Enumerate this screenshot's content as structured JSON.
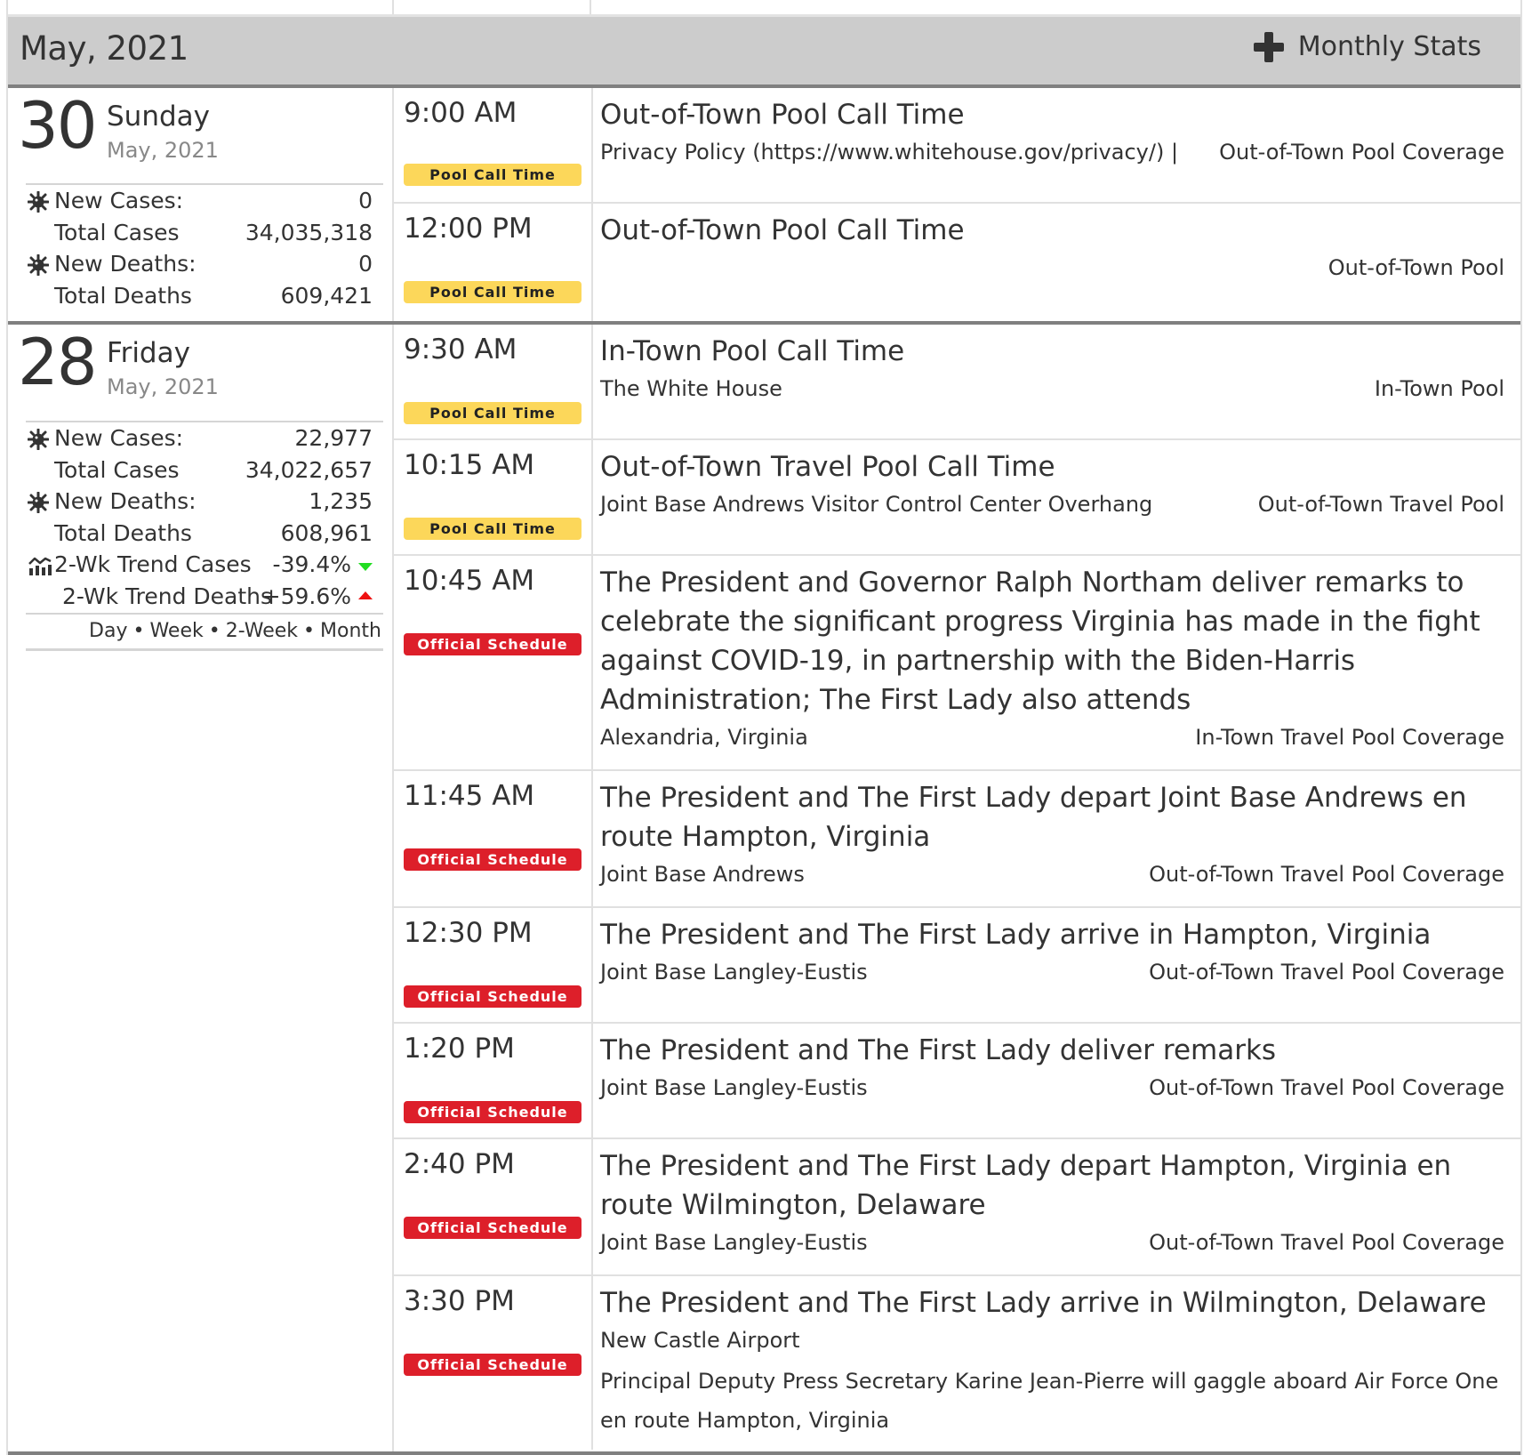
{
  "header": {
    "month_title": "May, 2021",
    "monthly_stats_label": "Monthly Stats",
    "monthly_stats_icon": "plus-icon"
  },
  "days": [
    {
      "day_number": "30",
      "weekday": "Sunday",
      "month_year": "May, 2021",
      "stats": {
        "new_cases_label": "New Cases:",
        "new_cases": "0",
        "total_cases_label": "Total Cases",
        "total_cases": "34,035,318",
        "new_deaths_label": "New Deaths:",
        "new_deaths": "0",
        "total_deaths_label": "Total Deaths",
        "total_deaths": "609,421"
      },
      "events": [
        {
          "time": "9:00 AM",
          "badge": "Pool Call Time",
          "badge_type": "pool",
          "title": "Out-of-Town Pool Call Time",
          "location": "Privacy Policy (https://www.whitehouse.gov/privacy/) |",
          "coverage": "Out-of-Town Pool Coverage"
        },
        {
          "time": "12:00 PM",
          "badge": "Pool Call Time",
          "badge_type": "pool",
          "title": "Out-of-Town Pool Call Time",
          "location": "",
          "coverage": "Out-of-Town Pool"
        }
      ]
    },
    {
      "day_number": "28",
      "weekday": "Friday",
      "month_year": "May, 2021",
      "stats": {
        "new_cases_label": "New Cases:",
        "new_cases": "22,977",
        "total_cases_label": "Total Cases",
        "total_cases": "34,022,657",
        "new_deaths_label": "New Deaths:",
        "new_deaths": "1,235",
        "total_deaths_label": "Total Deaths",
        "total_deaths": "608,961",
        "trend_cases_label": "2-Wk Trend Cases",
        "trend_cases": "-39.4%",
        "trend_cases_direction": "down",
        "trend_deaths_label": "2-Wk Trend Deaths",
        "trend_deaths": "+59.6%",
        "trend_deaths_direction": "up"
      },
      "range_links": [
        "Day",
        "Week",
        "2-Week",
        "Month"
      ],
      "range_separator": "•",
      "events": [
        {
          "time": "9:30 AM",
          "badge": "Pool Call Time",
          "badge_type": "pool",
          "title": "In-Town Pool Call Time",
          "location": "The White House",
          "coverage": "In-Town Pool"
        },
        {
          "time": "10:15 AM",
          "badge": "Pool Call Time",
          "badge_type": "pool",
          "title": "Out-of-Town Travel Pool Call Time",
          "location": "Joint Base Andrews Visitor Control Center Overhang",
          "coverage": "Out-of-Town Travel Pool"
        },
        {
          "time": "10:45 AM",
          "badge": "Official Schedule",
          "badge_type": "official",
          "title": "The President and Governor Ralph Northam deliver remarks to celebrate the significant progress Virginia has made in the fight against COVID-19, in partnership with the Biden-Harris Administration; The First Lady also attends",
          "location": "Alexandria, Virginia",
          "coverage": "In-Town Travel Pool Coverage"
        },
        {
          "time": "11:45 AM",
          "badge": "Official Schedule",
          "badge_type": "official",
          "title": "The President and The First Lady depart Joint Base Andrews en route Hampton, Virginia",
          "location": "Joint Base Andrews",
          "coverage": "Out-of-Town Travel Pool Coverage"
        },
        {
          "time": "12:30 PM",
          "badge": "Official Schedule",
          "badge_type": "official",
          "title": "The President and The First Lady arrive in Hampton, Virginia",
          "location": "Joint Base Langley-Eustis",
          "coverage": "Out-of-Town Travel Pool Coverage"
        },
        {
          "time": "1:20 PM",
          "badge": "Official Schedule",
          "badge_type": "official",
          "title": "The President and The First Lady deliver remarks",
          "location": "Joint Base Langley-Eustis",
          "coverage": "Out-of-Town Travel Pool Coverage"
        },
        {
          "time": "2:40 PM",
          "badge": "Official Schedule",
          "badge_type": "official",
          "title": "The President and The First Lady depart Hampton, Virginia en route Wilmington, Delaware",
          "location": "Joint Base Langley-Eustis",
          "coverage": "Out-of-Town Travel Pool Coverage"
        },
        {
          "time": "3:30 PM",
          "badge": "Official Schedule",
          "badge_type": "official",
          "title": "The President and The First Lady arrive in Wilmington, Delaware",
          "location": "New Castle Airport",
          "coverage": "",
          "note": "Principal Deputy Press Secretary Karine Jean-Pierre will gaggle aboard Air Force One en route Hampton, Virginia"
        }
      ]
    }
  ],
  "colors": {
    "pool_badge": "#fcd75a",
    "official_badge": "#dd1f2a",
    "header_bg": "#cccccc",
    "trend_down": "#22dd22",
    "trend_up": "#ee1111"
  }
}
